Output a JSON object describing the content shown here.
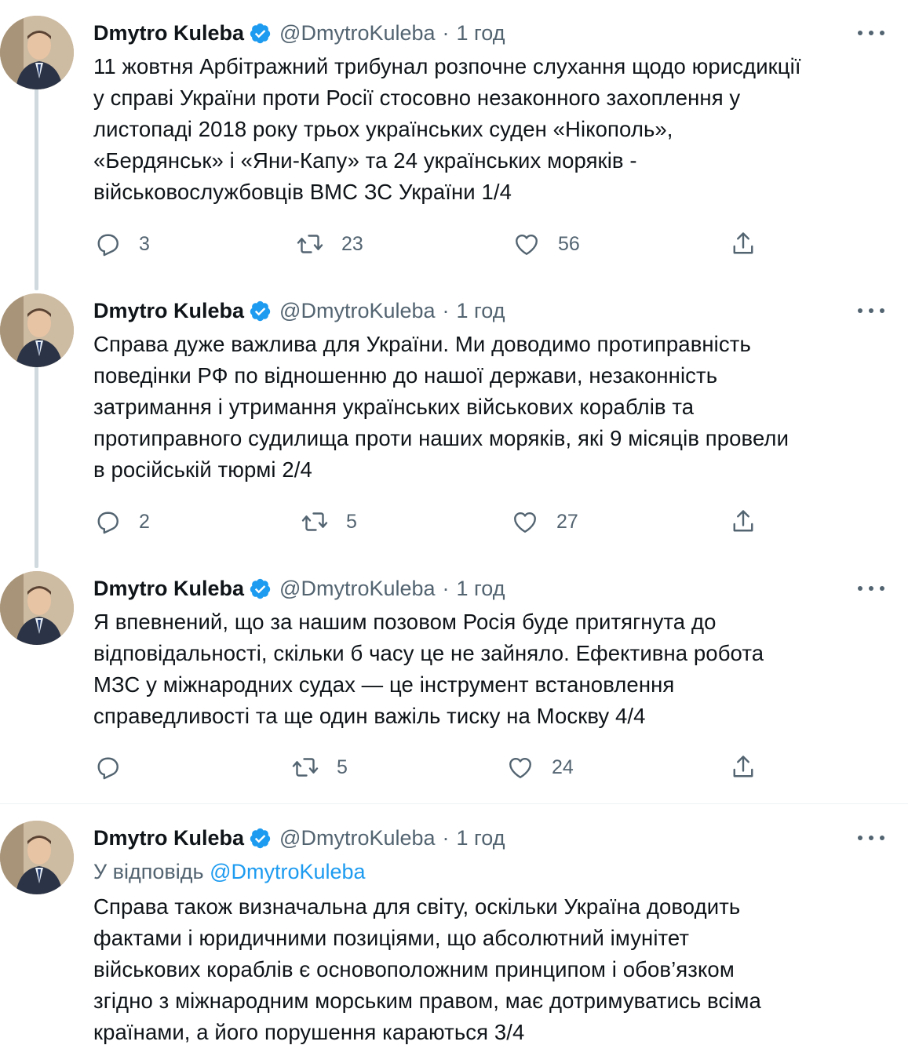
{
  "tweets": [
    {
      "author": {
        "name": "Dmytro Kuleba",
        "handle": "@DmytroKuleba",
        "time": "1 год"
      },
      "reply_to_prefix": "",
      "reply_to_mention": "",
      "text": "11 жовтня Арбітражний трибунал розпочне слухання щодо юрисдикції\nу справі України проти Росії стосовно незаконного захоплення у\nлистопаді 2018 року трьох українських суден «Нікополь»,\n«Бердянськ» і «Яни-Капу» та 24 українських моряків -\nвійськовослужбовців ВМС ЗС України 1/4",
      "stats": {
        "replies": "3",
        "retweets": "23",
        "likes": "56"
      }
    },
    {
      "author": {
        "name": "Dmytro Kuleba",
        "handle": "@DmytroKuleba",
        "time": "1 год"
      },
      "reply_to_prefix": "",
      "reply_to_mention": "",
      "text": "Справа дуже важлива для України. Ми доводимо протиправність\nповедінки РФ по відношенню до нашої держави, незаконність\nзатримання і утримання українських військових кораблів та\nпротиправного судилища проти наших моряків, які 9 місяців провели\nв російській тюрмі 2/4",
      "stats": {
        "replies": "2",
        "retweets": "5",
        "likes": "27"
      }
    },
    {
      "author": {
        "name": "Dmytro Kuleba",
        "handle": "@DmytroKuleba",
        "time": "1 год"
      },
      "reply_to_prefix": "",
      "reply_to_mention": "",
      "text": "Я впевнений, що за нашим позовом Росія буде притягнута до\nвідповідальності, скільки б часу це не зайняло. Ефективна робота\nМЗС у міжнародних судах — це інструмент встановлення\nсправедливості та ще один важіль тиску на Москву 4/4",
      "stats": {
        "replies": "",
        "retweets": "5",
        "likes": "24"
      }
    },
    {
      "author": {
        "name": "Dmytro Kuleba",
        "handle": "@DmytroKuleba",
        "time": "1 год"
      },
      "reply_to_prefix": "У відповідь ",
      "reply_to_mention": "@DmytroKuleba",
      "text": "Справа також визначальна для світу, оскільки Україна доводить\nфактами і юридичними позиціями, що абсолютний імунітет\nвійськових кораблів є основоположним принципом і обов’язком\nзгідно з міжнародним морським правом, має дотримуватись всіма\nкраїнами, а його порушення караються 3/4",
      "stats": {
        "replies": "",
        "retweets": "",
        "likes": ""
      }
    }
  ],
  "dot_separator": "·",
  "colors": {
    "verified": "#1d9bf0",
    "secondary": "#536471",
    "thread_line": "#cfd9de"
  },
  "icons": [
    "verified-badge-icon",
    "more-icon",
    "reply-icon",
    "retweet-icon",
    "like-icon",
    "share-icon"
  ]
}
